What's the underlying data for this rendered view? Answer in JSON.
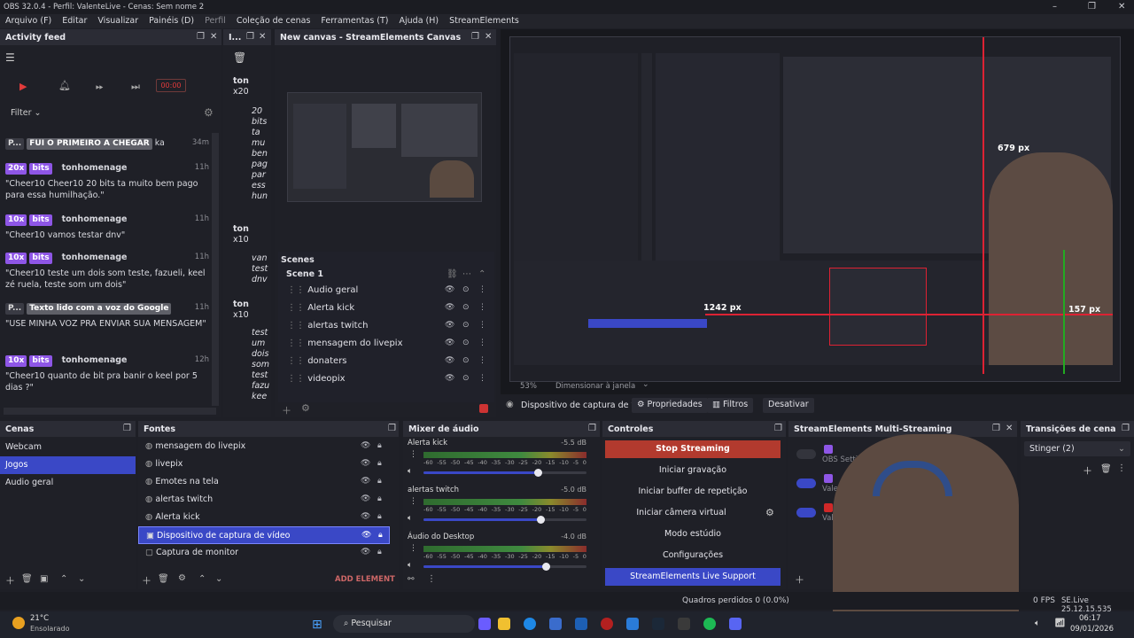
{
  "window": {
    "title": "OBS 32.0.4 - Perfil: ValenteLive - Cenas: Sem nome 2",
    "min": "–",
    "max": "❐",
    "close": "✕"
  },
  "menu": [
    "Arquivo (F)",
    "Editar",
    "Visualizar",
    "Painéis (D)",
    "Perfil",
    "Coleção de cenas",
    "Ferramentas (T)",
    "Ajuda (H)",
    "StreamElements"
  ],
  "activity": {
    "title": "Activity feed",
    "timer": "00:00",
    "filter": "Filter",
    "items": [
      {
        "user": "P...",
        "tag": "FUI O PRIMEIRO A CHEGAR",
        "extra": "ka",
        "time": "34m",
        "msg": ""
      },
      {
        "user": "",
        "tag": "20x",
        "label": "bits",
        "name": "tonhomenage",
        "time": "11h",
        "msg": "\"Cheer10 Cheer10 20 bits ta muito bem pago para essa humilhação.\""
      },
      {
        "user": "",
        "tag": "10x",
        "label": "bits",
        "name": "tonhomenage",
        "time": "11h",
        "msg": "\"Cheer10 vamos testar dnv\""
      },
      {
        "user": "",
        "tag": "10x",
        "label": "bits",
        "name": "tonhomenage",
        "time": "11h",
        "msg": "\"Cheer10 teste um dois som teste, fazueli, keel zé ruela, teste som um dois\""
      },
      {
        "user": "P...",
        "tag": "Texto lido com a voz do Google",
        "time": "11h",
        "msg": "\"USE MINHA VOZ PRA ENVIAR SUA MENSAGEM\""
      },
      {
        "user": "",
        "tag": "10x",
        "label": "bits",
        "name": "tonhomenage",
        "time": "12h",
        "msg": "\"Cheer10 quanto de bit pra banir o keel por 5 dias ?\""
      }
    ]
  },
  "mini_feed": {
    "head": "I...",
    "items": [
      {
        "name": "ton",
        "sub": "x20",
        "lines": [
          "20",
          "bits",
          "ta",
          "mu",
          "ben",
          "pag",
          "par",
          "ess",
          "hun"
        ]
      },
      {
        "name": "ton",
        "sub": "x10",
        "lines": [
          "van",
          "test",
          "dnv"
        ]
      },
      {
        "name": "ton",
        "sub": "x10",
        "lines": [
          "test",
          "um",
          "dois",
          "som",
          "test",
          "fazu",
          "kee"
        ]
      }
    ]
  },
  "canvas": {
    "title": "New canvas - StreamElements Canvas",
    "scenes_label": "Scenes",
    "scene": "Scene 1",
    "sources": [
      "Audio geral",
      "Alerta kick",
      "alertas twitch",
      "mensagem do livepix",
      "donaters",
      "videopix"
    ]
  },
  "preview": {
    "zoom": "53%",
    "resize": "Dimensionar à janela",
    "measure1": "679 px",
    "measure2": "1242 px",
    "measure3": "157 px"
  },
  "source_toolbar": {
    "source": "Dispositivo de captura de v",
    "props": "Propriedades",
    "filters": "Filtros",
    "deactivate": "Desativar"
  },
  "scenes": {
    "title": "Cenas",
    "items": [
      "Webcam",
      "Jogos",
      "Audio geral"
    ],
    "selected": 1
  },
  "sources": {
    "title": "Fontes",
    "items": [
      "mensagem do livepix",
      "livepix",
      "Emotes na tela",
      "alertas twitch",
      "Alerta kick",
      "Dispositivo de captura de vídeo",
      "Captura de monitor"
    ],
    "selected": 5,
    "add_element": "ADD ELEMENT"
  },
  "mixer": {
    "title": "Mixer de áudio",
    "channels": [
      {
        "name": "Alerta kick",
        "db": "-5.5 dB",
        "level": 0.7
      },
      {
        "name": "alertas twitch",
        "db": "-5.0 dB",
        "level": 0.72
      },
      {
        "name": "Áudio do Desktop",
        "db": "-4.0 dB",
        "level": 0.75
      }
    ],
    "scale": [
      "-60",
      "-55",
      "-50",
      "-45",
      "-40",
      "-35",
      "-30",
      "-25",
      "-20",
      "-15",
      "-10",
      "-5",
      "0"
    ]
  },
  "controls": {
    "title": "Controles",
    "buttons": [
      "Stop Streaming",
      "Iniciar gravação",
      "Iniciar buffer de repetição",
      "Iniciar câmera virtual",
      "Modo estúdio",
      "Configurações",
      "StreamElements Live Support"
    ]
  },
  "multistream": {
    "title": "StreamElements Multi-Streaming",
    "rows": [
      {
        "label": "OBS Setting: Twitch"
      },
      {
        "label": "Valen"
      },
      {
        "label": "Valen"
      }
    ],
    "accent": "#3a48c6"
  },
  "transitions": {
    "title": "Transições de cena",
    "selected": "Stinger (2)"
  },
  "statusbar": {
    "dropped": "Quadros perdidos 0 (0.0%)",
    "fps": "0 FPS",
    "version": "SE.Live 25.12.15.535"
  },
  "taskbar": {
    "temp": "21°C",
    "weather": "Ensolarado",
    "search": "Pesquisar",
    "time": "06:17",
    "date": "09/01/2026"
  }
}
